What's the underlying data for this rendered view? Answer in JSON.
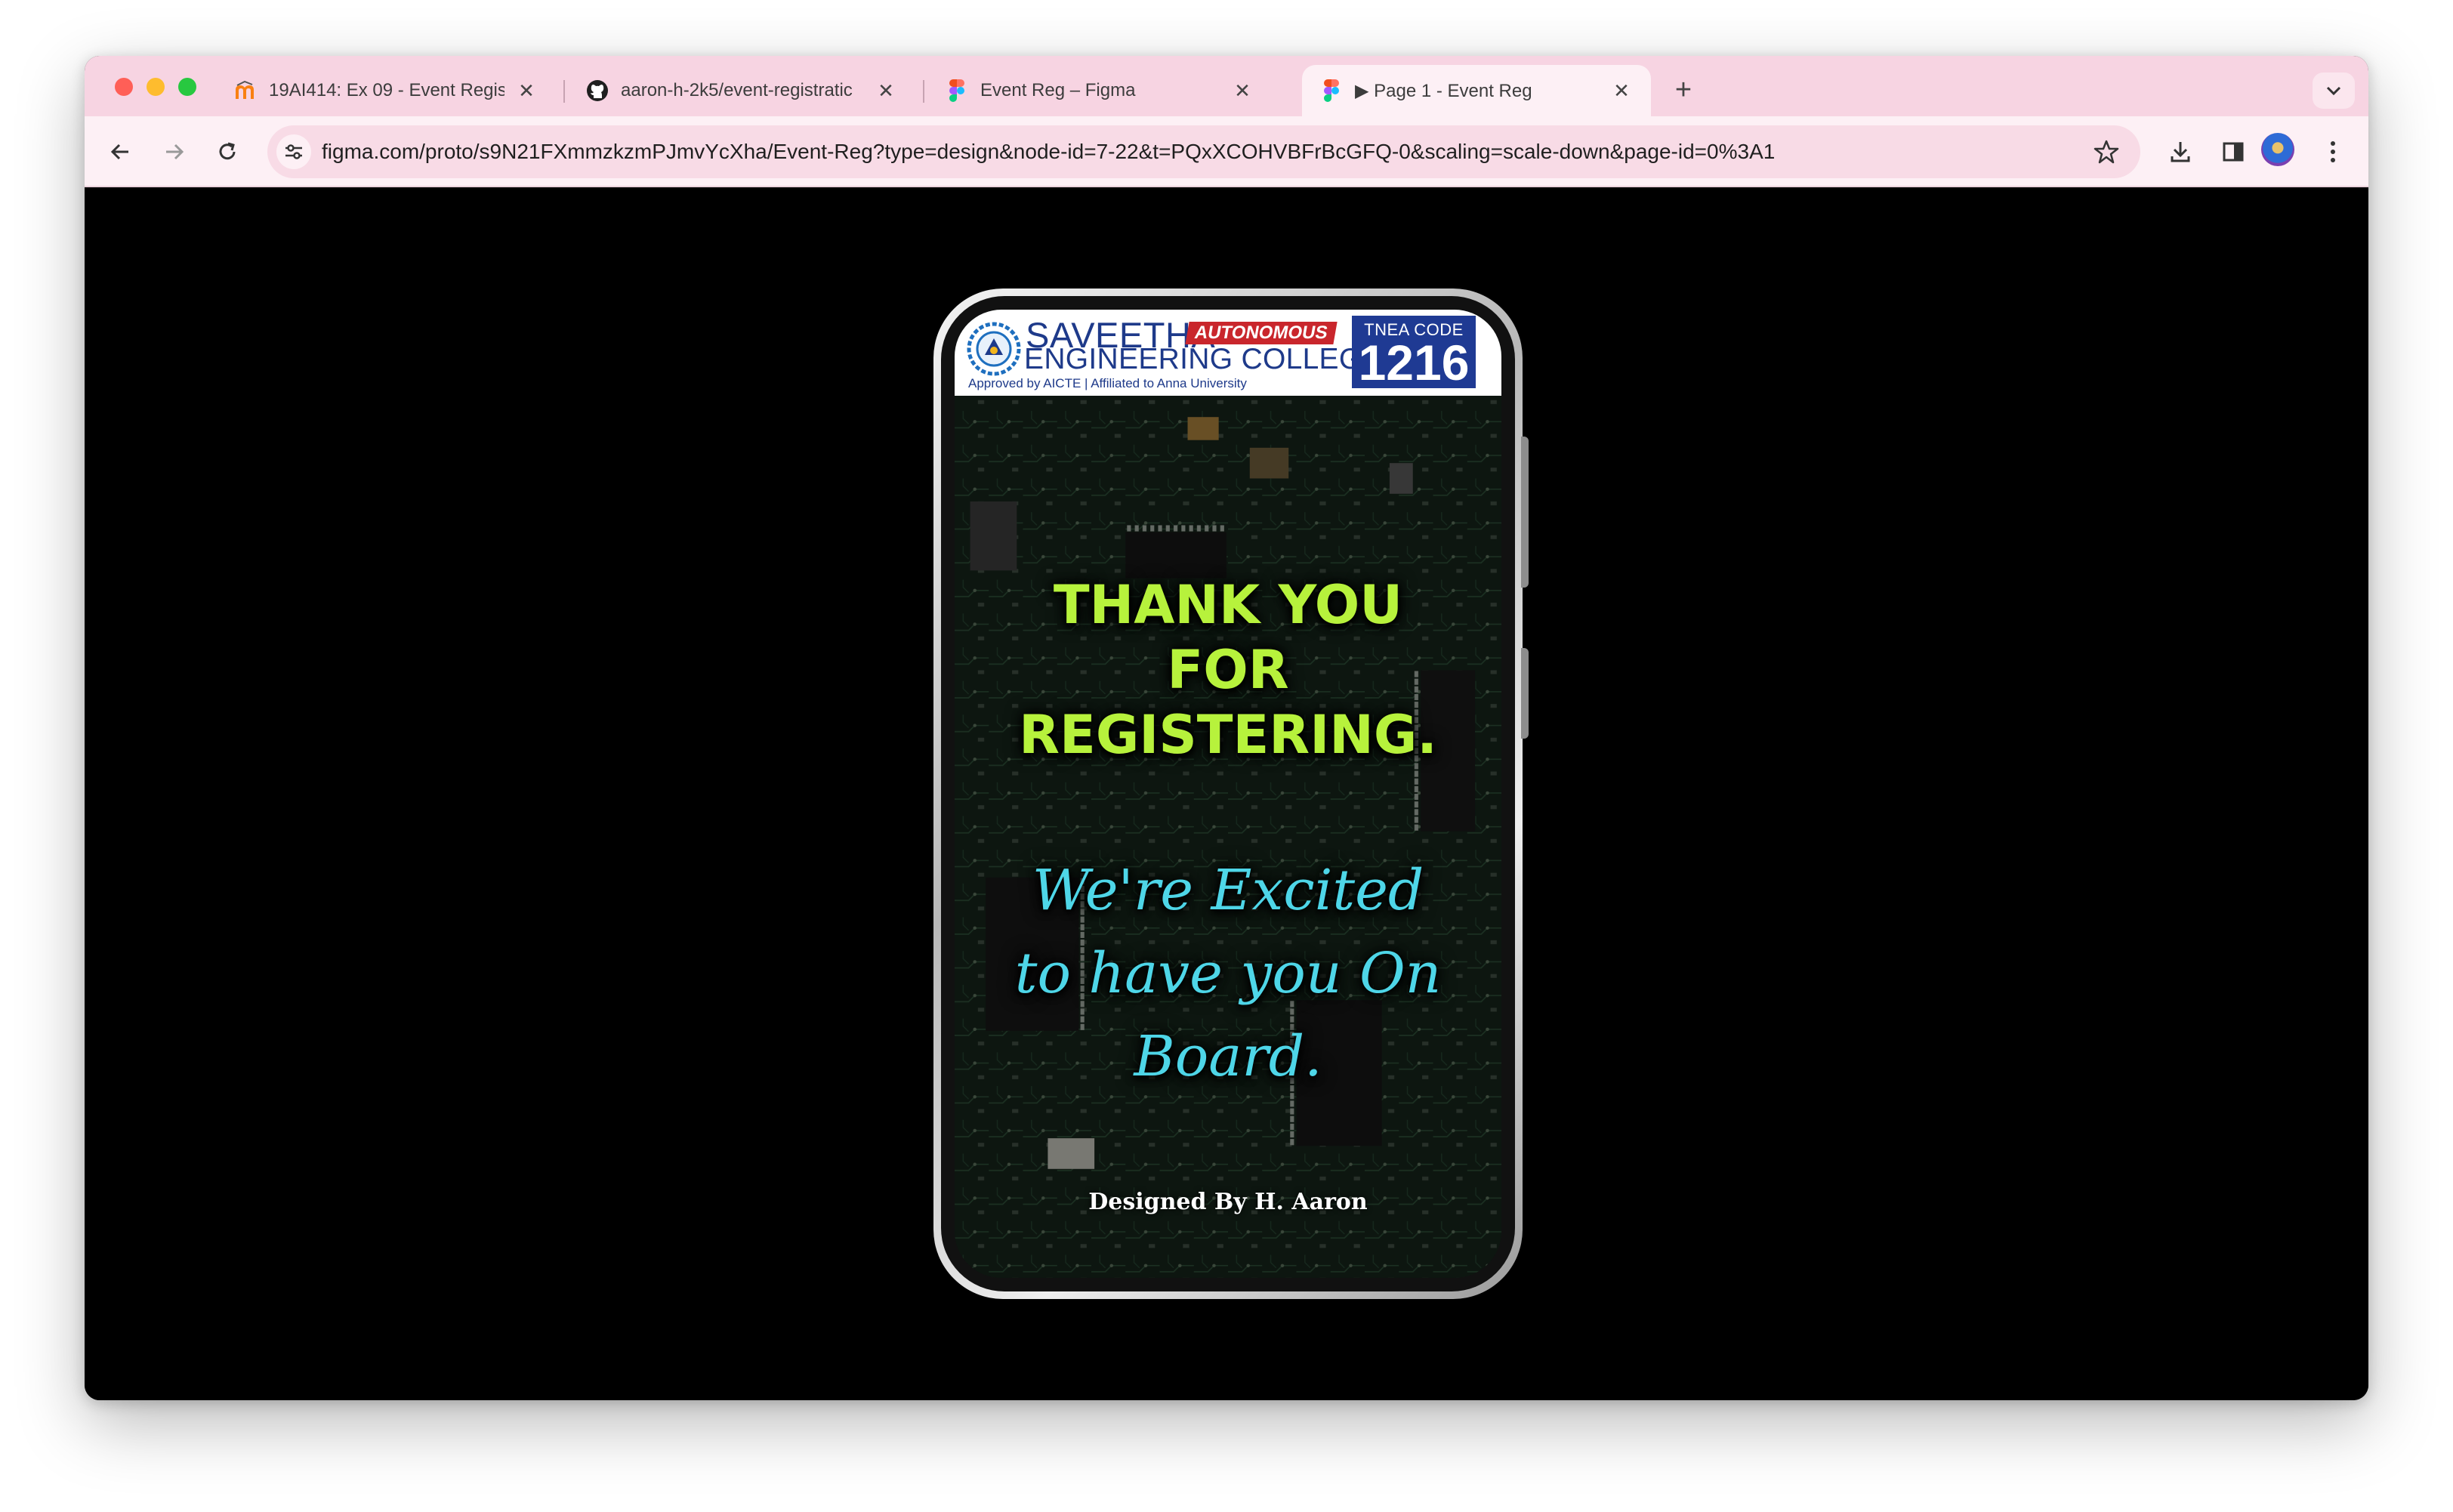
{
  "browser": {
    "tabs": [
      {
        "title": "19AI414: Ex 09 - Event Regist",
        "favicon": "moodle-icon",
        "active": false
      },
      {
        "title": "aaron-h-2k5/event-registratic",
        "favicon": "github-icon",
        "active": false
      },
      {
        "title": "Event Reg – Figma",
        "favicon": "figma-icon",
        "active": false
      },
      {
        "title": "▶ Page 1 - Event Reg",
        "favicon": "figma-icon",
        "active": true
      }
    ],
    "new_tab_label": "+",
    "url": "figma.com/proto/s9N21FXmmzkzmPJmvYcXha/Event-Reg?type=design&node-id=7-22&t=PQxXCOHVBFrBcGFQ-0&scaling=scale-down&page-id=0%3A1",
    "colors": {
      "tabstrip": "#f7d4e2",
      "toolbar": "#fdf0f5",
      "omnibox": "#f8dbe6"
    }
  },
  "poster": {
    "college_name_line1": "SAVEETHA",
    "autonomous_badge": "AUTONOMOUS",
    "college_name_line2": "ENGINEERING COLLEGE",
    "approved_text": "Approved by AICTE | Affiliated to Anna University",
    "tnea_label": "TNEA CODE",
    "tnea_code": "1216",
    "thank_you_lines": [
      "THANK YOU",
      "FOR",
      "REGISTERING."
    ],
    "excited_lines": [
      "We're Excited",
      "to have you On",
      "Board."
    ],
    "designed_by": "Designed By H. Aaron",
    "colors": {
      "thank_you": "#b7f23c",
      "excited": "#4ed6e8",
      "brand_blue": "#1e3a8a",
      "badge_red": "#c9262c"
    }
  }
}
